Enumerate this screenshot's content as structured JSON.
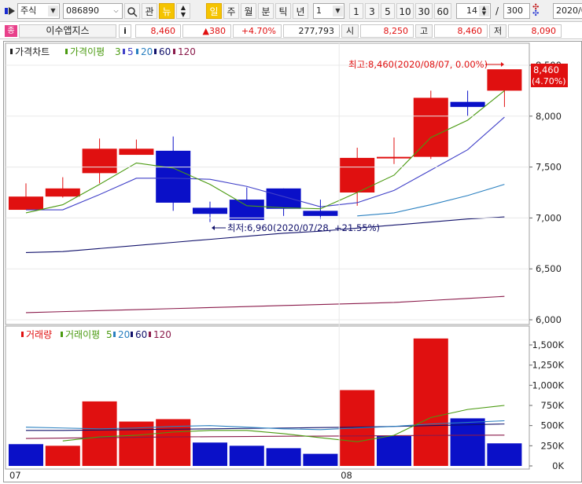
{
  "toolbar": {
    "market_select": "주식",
    "code_input": "086890",
    "btn_gwan": "관",
    "btn_nyu": "뉴",
    "btn_il": "일",
    "btn_ju": "주",
    "btn_wol": "월",
    "btn_bun": "분",
    "btn_tik": "틱",
    "btn_nyeon": "년",
    "period_select": "1",
    "periods": [
      "1",
      "3",
      "5",
      "10",
      "30",
      "60"
    ],
    "count_value": "14",
    "slash": "/",
    "total_value": "300",
    "date_value": "2020/0"
  },
  "info": {
    "company_name": "이수앱지스",
    "company_badge": "종",
    "info_btn": "i",
    "price": "8,460",
    "change": "▲380",
    "change_pct": "+4.70%",
    "volume": "277,793",
    "open_label": "시",
    "open": "8,250",
    "high_label": "고",
    "high": "8,460",
    "low_label": "저",
    "low": "8,090"
  },
  "price_legend": {
    "title": "가격차트",
    "ma_label": "가격이평",
    "ma_periods": [
      "3",
      "5",
      "20",
      "60",
      "120"
    ]
  },
  "volume_legend": {
    "title": "거래량",
    "ma_label": "거래이평",
    "ma_periods": [
      "5",
      "20",
      "60",
      "120"
    ]
  },
  "annotations": {
    "high": "최고:8,460(2020/08/07, 0.00%)",
    "low": "최저:6,960(2020/07/28, +21.55%)"
  },
  "last_price_box": {
    "price": "8,460",
    "pct": "(4.70%)"
  },
  "colors": {
    "up": "#e01010",
    "down": "#0a10c8",
    "ma3": "#4a9a10",
    "ma5": "#4040c8",
    "ma20": "#2a80c0",
    "ma60": "#10106a",
    "ma120": "#8a1a4a",
    "vma5": "#4a9a10",
    "vma20": "#2a80c0",
    "vma60": "#10106a",
    "vma120": "#8a1a4a"
  },
  "chart_data": [
    {
      "type": "candlestick",
      "title": "가격차트",
      "ylim": [
        6000,
        8700
      ],
      "yticks": [
        6000,
        6500,
        7000,
        7500,
        8000,
        8500
      ],
      "ytick_labels": [
        "6,000",
        "6,500",
        "7,000",
        "7,500",
        "8,000",
        "8,500"
      ],
      "x_labels": [
        {
          "label": "07",
          "index": 0
        },
        {
          "label": "08",
          "index": 9
        }
      ],
      "candles": [
        {
          "open": 7080,
          "close": 7210,
          "high": 7340,
          "low": 7080
        },
        {
          "open": 7210,
          "close": 7290,
          "high": 7400,
          "low": 7200
        },
        {
          "open": 7440,
          "close": 7680,
          "high": 7780,
          "low": 7340
        },
        {
          "open": 7620,
          "close": 7680,
          "high": 7770,
          "low": 7620
        },
        {
          "open": 7660,
          "close": 7150,
          "high": 7800,
          "low": 7070
        },
        {
          "open": 7100,
          "close": 7040,
          "high": 7160,
          "low": 6960
        },
        {
          "open": 7180,
          "close": 6980,
          "high": 7300,
          "low": 6980
        },
        {
          "open": 7290,
          "close": 7090,
          "high": 7290,
          "low": 7020
        },
        {
          "open": 7070,
          "close": 7020,
          "high": 7180,
          "low": 6990
        },
        {
          "open": 7250,
          "close": 7590,
          "high": 7690,
          "low": 7120
        },
        {
          "open": 7590,
          "close": 7600,
          "high": 7790,
          "low": 7530
        },
        {
          "open": 7600,
          "close": 8180,
          "high": 8250,
          "low": 7580
        },
        {
          "open": 8140,
          "close": 8090,
          "high": 8250,
          "low": 8000
        },
        {
          "open": 8250,
          "close": 8460,
          "high": 8460,
          "low": 8090
        }
      ],
      "ma": {
        "ma3": [
          7050,
          7130,
          7330,
          7540,
          7490,
          7330,
          7120,
          7100,
          7090,
          7250,
          7420,
          7790,
          7960,
          8250
        ],
        "ma5": [
          7080,
          7080,
          7230,
          7390,
          7390,
          7380,
          7310,
          7210,
          7110,
          7150,
          7270,
          7470,
          7670,
          7990
        ],
        "ma20": [
          null,
          null,
          null,
          null,
          null,
          null,
          null,
          null,
          null,
          7020,
          7050,
          7130,
          7220,
          7330
        ],
        "ma60": [
          6660,
          6670,
          6700,
          6730,
          6760,
          6790,
          6820,
          6850,
          6870,
          6900,
          6930,
          6960,
          6990,
          7010
        ],
        "ma120": [
          6070,
          6080,
          6090,
          6100,
          6110,
          6120,
          6130,
          6140,
          6150,
          6160,
          6170,
          6190,
          6210,
          6230
        ]
      }
    },
    {
      "type": "bar",
      "title": "거래량",
      "ylim": [
        0,
        1650000
      ],
      "yticks": [
        0,
        250000,
        500000,
        750000,
        1000000,
        1250000,
        1500000
      ],
      "ytick_labels": [
        "0K",
        "250K",
        "500K",
        "750K",
        "1,000K",
        "1,250K",
        "1,500K"
      ],
      "values": [
        270000,
        250000,
        800000,
        550000,
        580000,
        290000,
        250000,
        220000,
        150000,
        940000,
        370000,
        1580000,
        590000,
        280000
      ],
      "up": [
        false,
        true,
        true,
        true,
        true,
        false,
        false,
        false,
        false,
        true,
        false,
        true,
        false,
        false
      ],
      "ma": {
        "vma5": [
          null,
          310000,
          360000,
          380000,
          420000,
          440000,
          440000,
          400000,
          350000,
          300000,
          380000,
          600000,
          700000,
          750000
        ],
        "vma20": [
          480000,
          470000,
          460000,
          470000,
          490000,
          500000,
          480000,
          460000,
          450000,
          470000,
          490000,
          520000,
          540000,
          560000
        ],
        "vma60": [
          440000,
          440000,
          445000,
          450000,
          455000,
          460000,
          465000,
          470000,
          475000,
          480000,
          490000,
          500000,
          510000,
          520000
        ],
        "vma120": [
          340000,
          345000,
          350000,
          355000,
          360000,
          362000,
          365000,
          368000,
          370000,
          372000,
          375000,
          378000,
          380000,
          382000
        ]
      }
    }
  ]
}
